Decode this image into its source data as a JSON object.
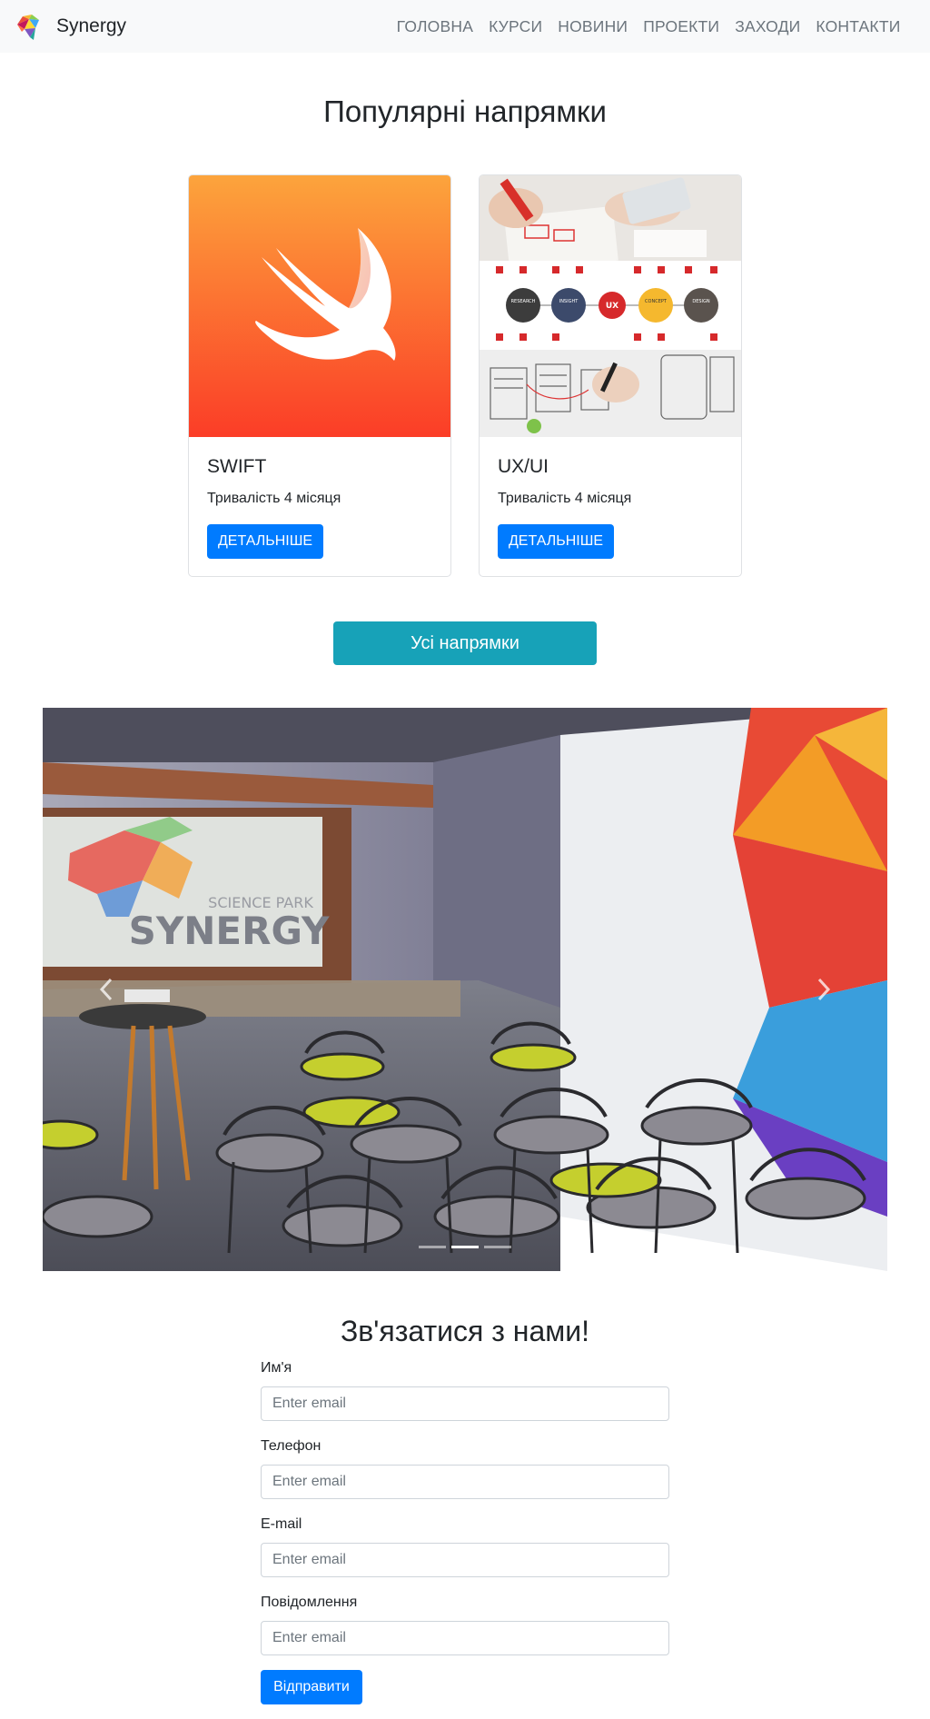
{
  "navbar": {
    "brand": "Synergy",
    "links": [
      "ГОЛОВНА",
      "КУРСИ",
      "НОВИНИ",
      "ПРОЕКТИ",
      "ЗАХОДИ",
      "КОНТАКТИ"
    ]
  },
  "popular": {
    "title": "Популярні напрямки",
    "cards": [
      {
        "title": "SWIFT",
        "text": "Тривалість 4 місяця",
        "button": "ДЕТАЛЬНІШЕ"
      },
      {
        "title": "UX/UI",
        "text": "Тривалість 4 місяця",
        "button": "ДЕТАЛЬНІШЕ"
      }
    ],
    "all_button": "Усі напрямки"
  },
  "carousel": {
    "screen_text_top": "SCIENCE PARK",
    "screen_text_main": "SYNERGY",
    "ux_diagram": [
      "RESEARCH",
      "INSIGHT",
      "UX",
      "CONCEPT",
      "DESIGN"
    ],
    "slide_count": 3,
    "active_index": 1
  },
  "contact": {
    "title": "Зв'язатися з нами!",
    "fields": [
      {
        "label": "Им'я",
        "placeholder": "Enter email"
      },
      {
        "label": "Телефон",
        "placeholder": "Enter email"
      },
      {
        "label": "E-mail",
        "placeholder": "Enter email"
      },
      {
        "label": "Повідомлення",
        "placeholder": "Enter email"
      }
    ],
    "submit": "Відправити"
  },
  "colors": {
    "primary": "#007bff",
    "info": "#17a2b8",
    "navbar_bg": "#f8f9fa",
    "swift_gradient_top": "#fca43c",
    "swift_gradient_bottom": "#fb3d27"
  }
}
